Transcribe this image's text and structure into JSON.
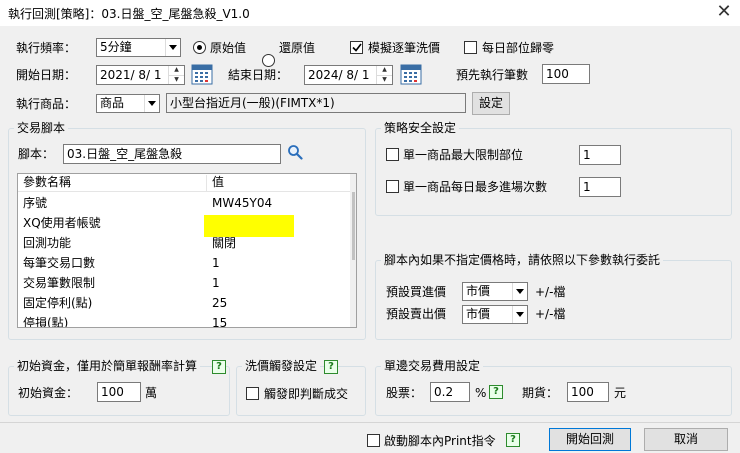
{
  "window": {
    "title": "執行回測[策略]：03.日盤_空_尾盤急殺_V1.0"
  },
  "top": {
    "freq_label": "執行頻率：",
    "freq_value": "5分鐘",
    "radio_original": "原始值",
    "radio_restore": "還原值",
    "chk_fill": "模擬逐筆洗價",
    "chk_zero": "每日部位歸零",
    "start_label": "開始日期：",
    "start_date": "2021/ 8/ 1",
    "end_label": "結束日期：",
    "end_date": "2024/ 8/ 1",
    "preexec_label": "預先執行筆數",
    "preexec_value": "100",
    "product_label": "執行商品：",
    "product_type": "商品",
    "product_name": "小型台指近月(一般)(FIMTX*1)",
    "set_button": "設定"
  },
  "script": {
    "group_title": "交易腳本",
    "script_label": "腳本：",
    "script_name": "03.日盤_空_尾盤急殺",
    "columns": [
      "參數名稱",
      "值"
    ],
    "rows": [
      {
        "name": "序號",
        "value": "MW45Y04"
      },
      {
        "name": "XQ使用者帳號",
        "value": ""
      },
      {
        "name": "回測功能",
        "value": "關閉"
      },
      {
        "name": "每筆交易口數",
        "value": "1"
      },
      {
        "name": "交易筆數限制",
        "value": "1"
      },
      {
        "name": "固定停利(點)",
        "value": "25"
      },
      {
        "name": "停損(點)",
        "value": "15"
      }
    ],
    "highlight_color": "#ffff00"
  },
  "safety": {
    "group_title": "策略安全設定",
    "max_pos_label": "單一商品最大限制部位",
    "max_pos_value": "1",
    "max_entry_label": "單一商品每日最多進場次數",
    "max_entry_value": "1"
  },
  "price": {
    "group_title": "腳本內如果不指定價格時，請依照以下參數執行委託",
    "buy_label": "預設買進價",
    "buy_value": "市價",
    "buy_tick": "+/-檔",
    "sell_label": "預設賣出價",
    "sell_value": "市價",
    "sell_tick": "+/-檔"
  },
  "capital": {
    "group_title": "初始資金，僅用於簡單報酬率計算",
    "label": "初始資金：",
    "value": "100",
    "unit": "萬"
  },
  "wash": {
    "group_title": "洗價觸發設定",
    "chk_label": "觸發即判斷成交"
  },
  "fees": {
    "group_title": "單邊交易費用設定",
    "stock_label": "股票：",
    "stock_value": "0.2",
    "stock_unit": "%",
    "futures_label": "期貨：",
    "futures_value": "100",
    "futures_unit": "元"
  },
  "footer": {
    "print_label": "啟動腳本內Print指令",
    "start_button": "開始回測",
    "cancel_button": "取消"
  },
  "help_glyph": "?"
}
